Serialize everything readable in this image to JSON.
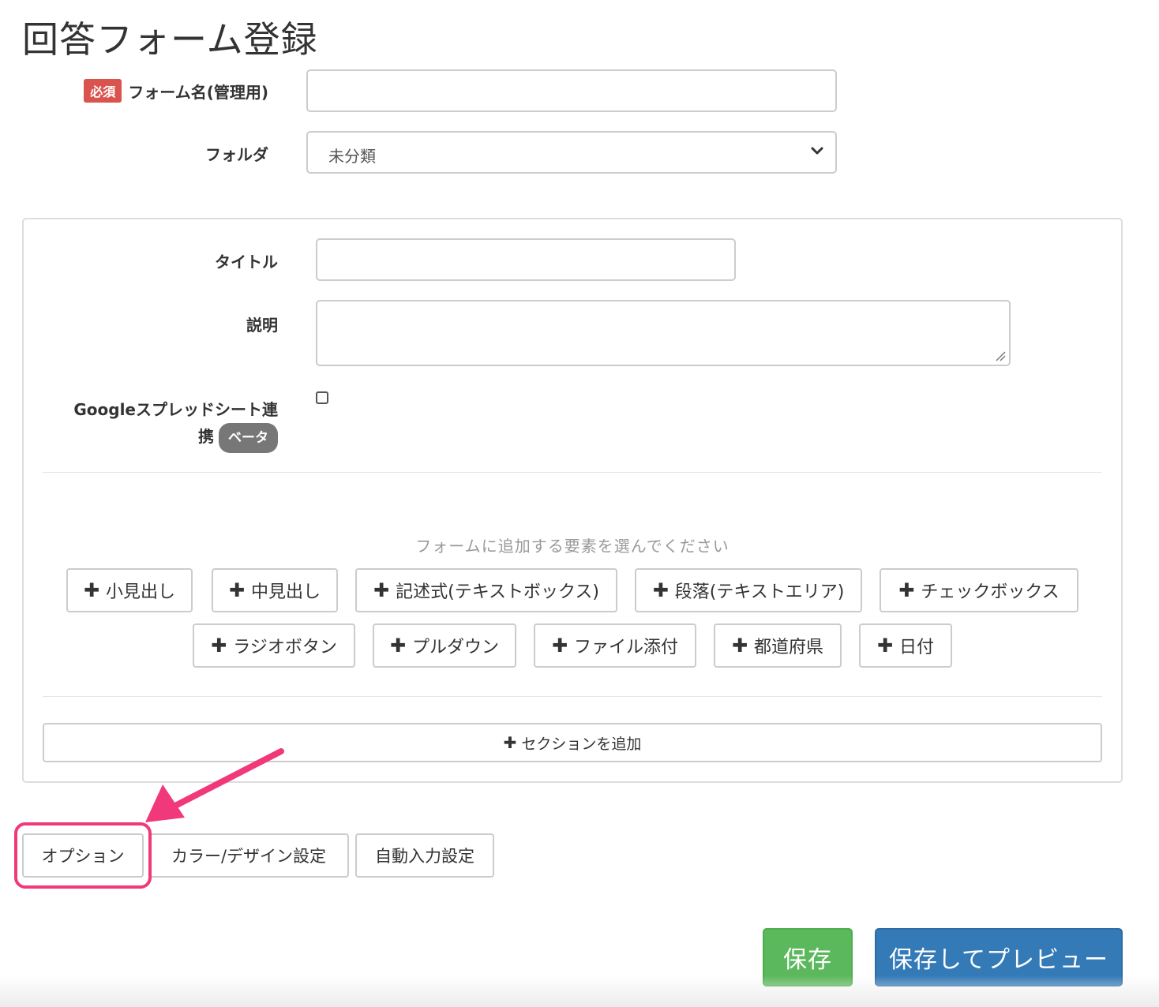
{
  "page": {
    "title": "回答フォーム登録"
  },
  "form": {
    "name": {
      "required_badge": "必須",
      "label": "フォーム名(管理用)",
      "value": ""
    },
    "folder": {
      "label": "フォルダ",
      "selected": "未分類"
    }
  },
  "panel": {
    "title": {
      "label": "タイトル",
      "value": ""
    },
    "description": {
      "label": "説明"
    },
    "google_sheet": {
      "label_line1": "Googleスプレッドシート連",
      "label_line2": "携",
      "beta_badge": "ベータ"
    },
    "hint": "フォームに追加する要素を選んでください",
    "elements": [
      "小見出し",
      "中見出し",
      "記述式(テキストボックス)",
      "段落(テキストエリア)",
      "チェックボックス",
      "ラジオボタン",
      "プルダウン",
      "ファイル添付",
      "都道府県",
      "日付"
    ],
    "add_section": "セクションを追加"
  },
  "tabs": [
    "オプション",
    "カラー/デザイン設定",
    "自動入力設定"
  ],
  "actions": {
    "save": "保存",
    "save_preview": "保存してプレビュー"
  },
  "colors": {
    "required": "#d9534f",
    "beta": "#777777",
    "save": "#5cb85c",
    "save_preview": "#337ab7",
    "highlight": "#f0387a"
  },
  "icons": {
    "plus": "plus-icon",
    "chevron": "chevron-down-icon",
    "arrow": "arrow-icon"
  }
}
